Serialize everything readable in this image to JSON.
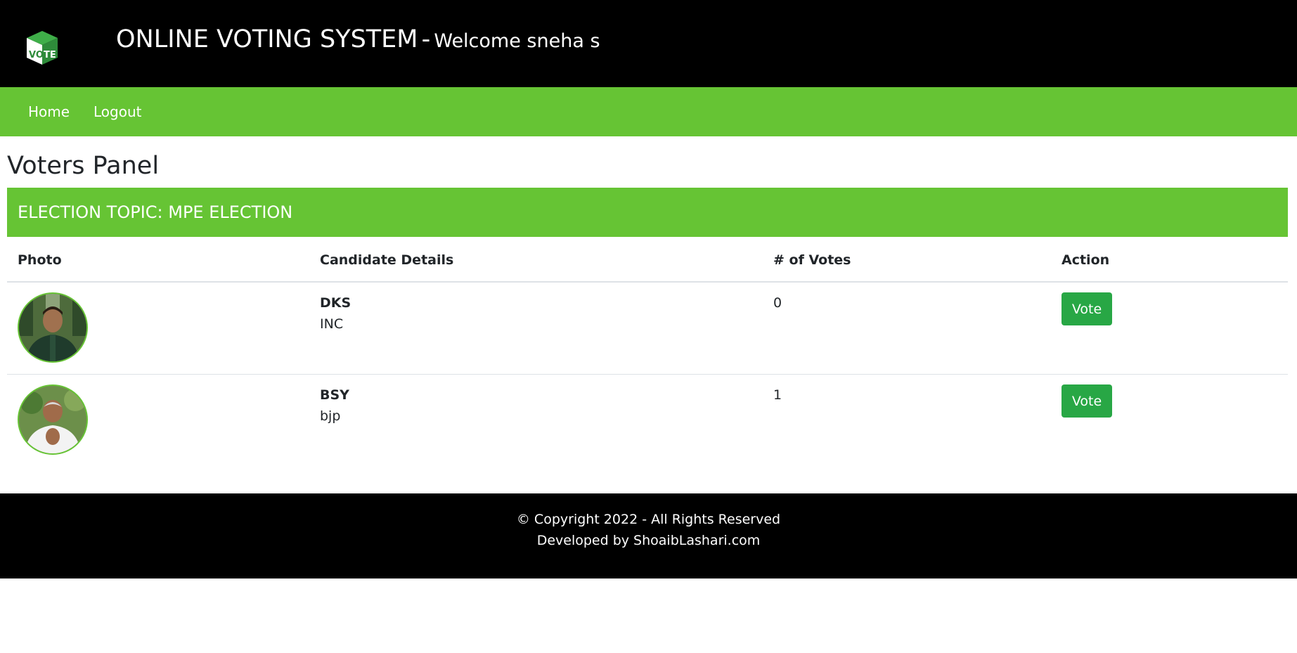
{
  "header": {
    "logo_text": "VOTE",
    "title": "ONLINE VOTING SYSTEM",
    "separator": "-",
    "welcome": "Welcome sneha s"
  },
  "nav": {
    "items": [
      {
        "label": "Home"
      },
      {
        "label": "Logout"
      }
    ]
  },
  "panel": {
    "title": "Voters Panel",
    "topic": "ELECTION TOPIC: MPE ELECTION"
  },
  "table": {
    "headers": {
      "photo": "Photo",
      "details": "Candidate Details",
      "votes": "# of Votes",
      "action": "Action"
    },
    "rows": [
      {
        "name": "DKS",
        "party": "INC",
        "votes": "0",
        "action_label": "Vote"
      },
      {
        "name": "BSY",
        "party": "bjp",
        "votes": "1",
        "action_label": "Vote"
      }
    ]
  },
  "footer": {
    "copyright": "© Copyright 2022 - All Rights Reserved",
    "developer": "Developed by ShoaibLashari.com"
  },
  "colors": {
    "header_bg": "#000000",
    "accent_green": "#66c434",
    "button_green": "#28a745",
    "footer_bg": "#000000"
  }
}
